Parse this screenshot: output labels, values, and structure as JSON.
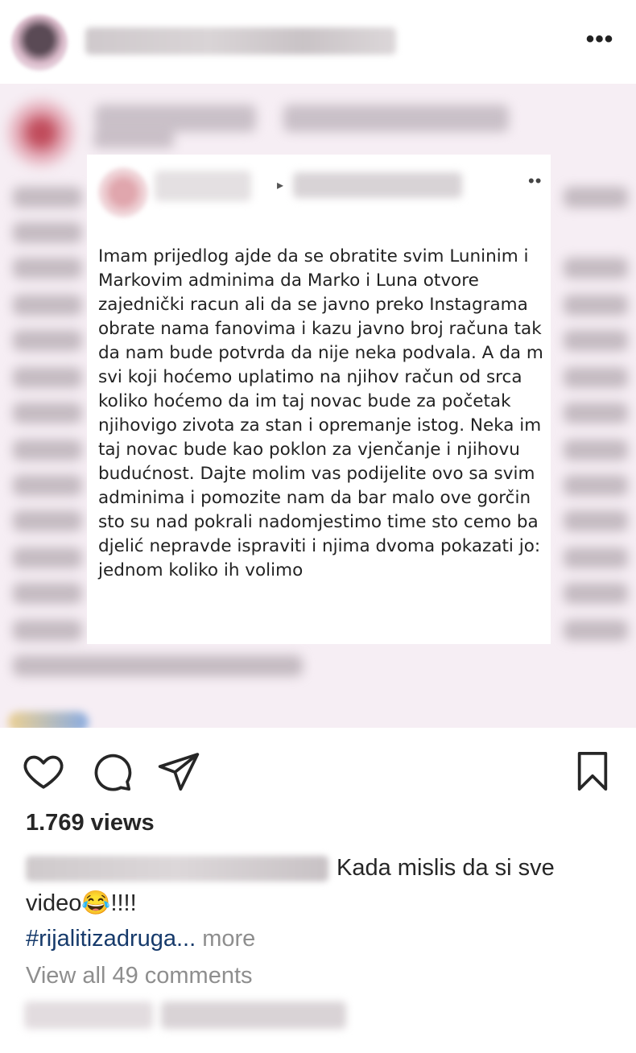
{
  "header": {
    "more_label": "•••"
  },
  "post": {
    "card_text": "Imam prijedlog ajde da se obratite svim Luninim i\nMarkovim adminima da Marko i Luna otvore\nzajednički racun ali da se javno preko Instagrama\nobrate nama fanovima i kazu javno broj računa tak\nda nam bude potvrda da nije neka podvala. A da m\nsvi koji hoćemo uplatimo na njihov račun od srca\nkoliko hoćemo da im taj novac bude za početak\nnjihovigo zivota za stan i opremanje istog. Neka im\ntaj novac bude kao poklon za vjenčanje i njihovu\nbudućnost. Dajte molim vas podijelite ovo sa svim\nadminima i pomozite nam da bar malo ove gorčin\nsto su nad pokrali nadomjestimo time sto cemo ba\ndjelić nepravde ispraviti i njima dvoma pokazati jo:\njednom koliko ih volimo",
    "arrow_icon": "▸",
    "card_dots": "••"
  },
  "actions": {
    "like_icon": "heart-icon",
    "comment_icon": "comment-icon",
    "share_icon": "send-icon",
    "save_icon": "bookmark-icon"
  },
  "views_label": "1.769 views",
  "caption": {
    "text": "Kada mislis da si sve video",
    "emoji": "😂",
    "suffix": "!!!!",
    "hashtag": "#rijalitizadruga...",
    "more": " more"
  },
  "comments_link": "View all 49 comments"
}
